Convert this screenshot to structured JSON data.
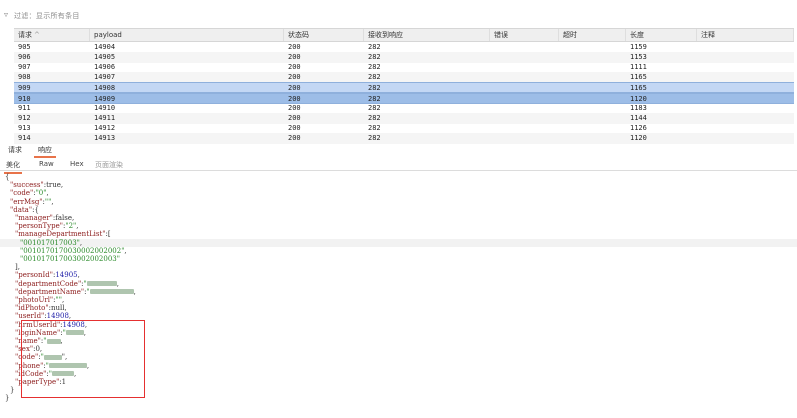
{
  "filter": {
    "icon": "funnel-icon",
    "text": "过滤：显示所有条目"
  },
  "table": {
    "columns": [
      "请求",
      "payload",
      "状态码",
      "接收到响应",
      "错误",
      "超时",
      "长度",
      "注释"
    ],
    "sort_indicator": "^",
    "rows": [
      [
        "905",
        "14904",
        "200",
        "282",
        "",
        "",
        "1159",
        ""
      ],
      [
        "906",
        "14905",
        "200",
        "282",
        "",
        "",
        "1153",
        ""
      ],
      [
        "907",
        "14906",
        "200",
        "282",
        "",
        "",
        "1111",
        ""
      ],
      [
        "908",
        "14907",
        "200",
        "282",
        "",
        "",
        "1165",
        ""
      ],
      [
        "909",
        "14908",
        "200",
        "282",
        "",
        "",
        "1165",
        ""
      ],
      [
        "910",
        "14909",
        "200",
        "282",
        "",
        "",
        "1120",
        ""
      ],
      [
        "911",
        "14910",
        "200",
        "282",
        "",
        "",
        "1183",
        ""
      ],
      [
        "912",
        "14911",
        "200",
        "282",
        "",
        "",
        "1144",
        ""
      ],
      [
        "913",
        "14912",
        "200",
        "282",
        "",
        "",
        "1126",
        ""
      ],
      [
        "914",
        "14913",
        "200",
        "282",
        "",
        "",
        "1120",
        ""
      ]
    ]
  },
  "tabs_primary": [
    "请求",
    "响应"
  ],
  "tabs_secondary": [
    "美化",
    "Raw",
    "Hex",
    "页面渲染"
  ],
  "code": [
    {
      "indent": 1,
      "parts": [
        [
          "p",
          "{"
        ]
      ]
    },
    {
      "indent": 2,
      "parts": [
        [
          "k",
          "\"success\""
        ],
        [
          "p",
          ":true,"
        ]
      ]
    },
    {
      "indent": 2,
      "parts": [
        [
          "k",
          "\"code\""
        ],
        [
          "p",
          ":"
        ],
        [
          "s",
          "\"0\""
        ],
        [
          "p",
          ","
        ]
      ]
    },
    {
      "indent": 2,
      "parts": [
        [
          "k",
          "\"errMsg\""
        ],
        [
          "p",
          ":"
        ],
        [
          "s",
          "\"\""
        ],
        [
          "p",
          ","
        ]
      ]
    },
    {
      "indent": 2,
      "parts": [
        [
          "k",
          "\"data\""
        ],
        [
          "p",
          ":{"
        ]
      ]
    },
    {
      "indent": 3,
      "parts": [
        [
          "k",
          "\"manager\""
        ],
        [
          "p",
          ":false,"
        ]
      ]
    },
    {
      "indent": 3,
      "parts": [
        [
          "k",
          "\"personType\""
        ],
        [
          "p",
          ":"
        ],
        [
          "s",
          "\"2\""
        ],
        [
          "p",
          ","
        ]
      ]
    },
    {
      "indent": 3,
      "parts": [
        [
          "k",
          "\"manageDepartmentList\""
        ],
        [
          "p",
          ":["
        ]
      ]
    },
    {
      "indent": 4,
      "hl": true,
      "parts": [
        [
          "s",
          "\"001017017003\""
        ],
        [
          "p",
          ","
        ]
      ]
    },
    {
      "indent": 4,
      "parts": [
        [
          "s",
          "\"0010170170030002002002\""
        ],
        [
          "p",
          ","
        ]
      ]
    },
    {
      "indent": 4,
      "parts": [
        [
          "s",
          "\"00101701700300200200​3\""
        ]
      ]
    },
    {
      "indent": 3,
      "parts": [
        [
          "p",
          "],"
        ]
      ]
    },
    {
      "indent": 3,
      "parts": [
        [
          "k",
          "\"personId\""
        ],
        [
          "p",
          ":"
        ],
        [
          "n",
          "14905"
        ],
        [
          "p",
          ","
        ]
      ]
    },
    {
      "indent": 3,
      "parts": [
        [
          "k",
          "\"departmentCode\""
        ],
        [
          "p",
          ":"
        ],
        [
          "s",
          "\""
        ],
        [
          "b",
          "30"
        ],
        [
          "p",
          ","
        ]
      ]
    },
    {
      "indent": 3,
      "parts": [
        [
          "k",
          "\"departmentName\""
        ],
        [
          "p",
          ":"
        ],
        [
          "s",
          "\""
        ],
        [
          "b",
          "44"
        ],
        [
          "p",
          ","
        ]
      ]
    },
    {
      "indent": 3,
      "parts": [
        [
          "k",
          "\"photoUrl\""
        ],
        [
          "p",
          ":"
        ],
        [
          "s",
          "\"\""
        ],
        [
          "p",
          ","
        ]
      ]
    },
    {
      "indent": 3,
      "parts": [
        [
          "k",
          "\"idPhoto\""
        ],
        [
          "p",
          ":null,"
        ]
      ]
    },
    {
      "indent": 3,
      "parts": [
        [
          "k",
          "\"userId\""
        ],
        [
          "p",
          ":"
        ],
        [
          "n",
          "14908"
        ],
        [
          "p",
          ","
        ]
      ]
    },
    {
      "indent": 3,
      "parts": [
        [
          "k",
          "\"hrmUserId\""
        ],
        [
          "p",
          ":"
        ],
        [
          "n",
          "14908"
        ],
        [
          "p",
          ","
        ]
      ]
    },
    {
      "indent": 3,
      "parts": [
        [
          "k",
          "\"loginName\""
        ],
        [
          "p",
          ":"
        ],
        [
          "s",
          "\""
        ],
        [
          "b",
          "18"
        ],
        [
          "p",
          ","
        ]
      ]
    },
    {
      "indent": 3,
      "parts": [
        [
          "k",
          "\"name\""
        ],
        [
          "p",
          ":"
        ],
        [
          "s",
          "\""
        ],
        [
          "b",
          "14"
        ],
        [
          "p",
          ","
        ]
      ]
    },
    {
      "indent": 3,
      "parts": [
        [
          "k",
          "\"sex\""
        ],
        [
          "p",
          ":0,"
        ]
      ]
    },
    {
      "indent": 3,
      "parts": [
        [
          "k",
          "\"code\""
        ],
        [
          "p",
          ":"
        ],
        [
          "s",
          "\""
        ],
        [
          "b",
          "18"
        ],
        [
          "p",
          "\","
        ]
      ]
    },
    {
      "indent": 3,
      "parts": [
        [
          "k",
          "\"phone\""
        ],
        [
          "p",
          ":"
        ],
        [
          "s",
          "\""
        ],
        [
          "b",
          "38"
        ],
        [
          "p",
          ","
        ]
      ]
    },
    {
      "indent": 3,
      "parts": [
        [
          "k",
          "\"idCode\""
        ],
        [
          "p",
          ":"
        ],
        [
          "s",
          "\""
        ],
        [
          "b",
          "22"
        ],
        [
          "p",
          ","
        ]
      ]
    },
    {
      "indent": 3,
      "parts": [
        [
          "k",
          "\"paperType\""
        ],
        [
          "p",
          ":1"
        ]
      ]
    },
    {
      "indent": 2,
      "parts": [
        [
          "p",
          "}"
        ]
      ]
    },
    {
      "indent": 1,
      "parts": [
        [
          "p",
          "}"
        ]
      ]
    }
  ],
  "colors": {
    "selected_row": "#c3d7f4",
    "selected_row_focus": "#9dbde7",
    "tab_underline": "#e8734a",
    "highlight_box": "#e53030",
    "json_key": "#8b1a1a",
    "json_string": "#2a8a2a",
    "json_number": "#1a1aa6"
  }
}
